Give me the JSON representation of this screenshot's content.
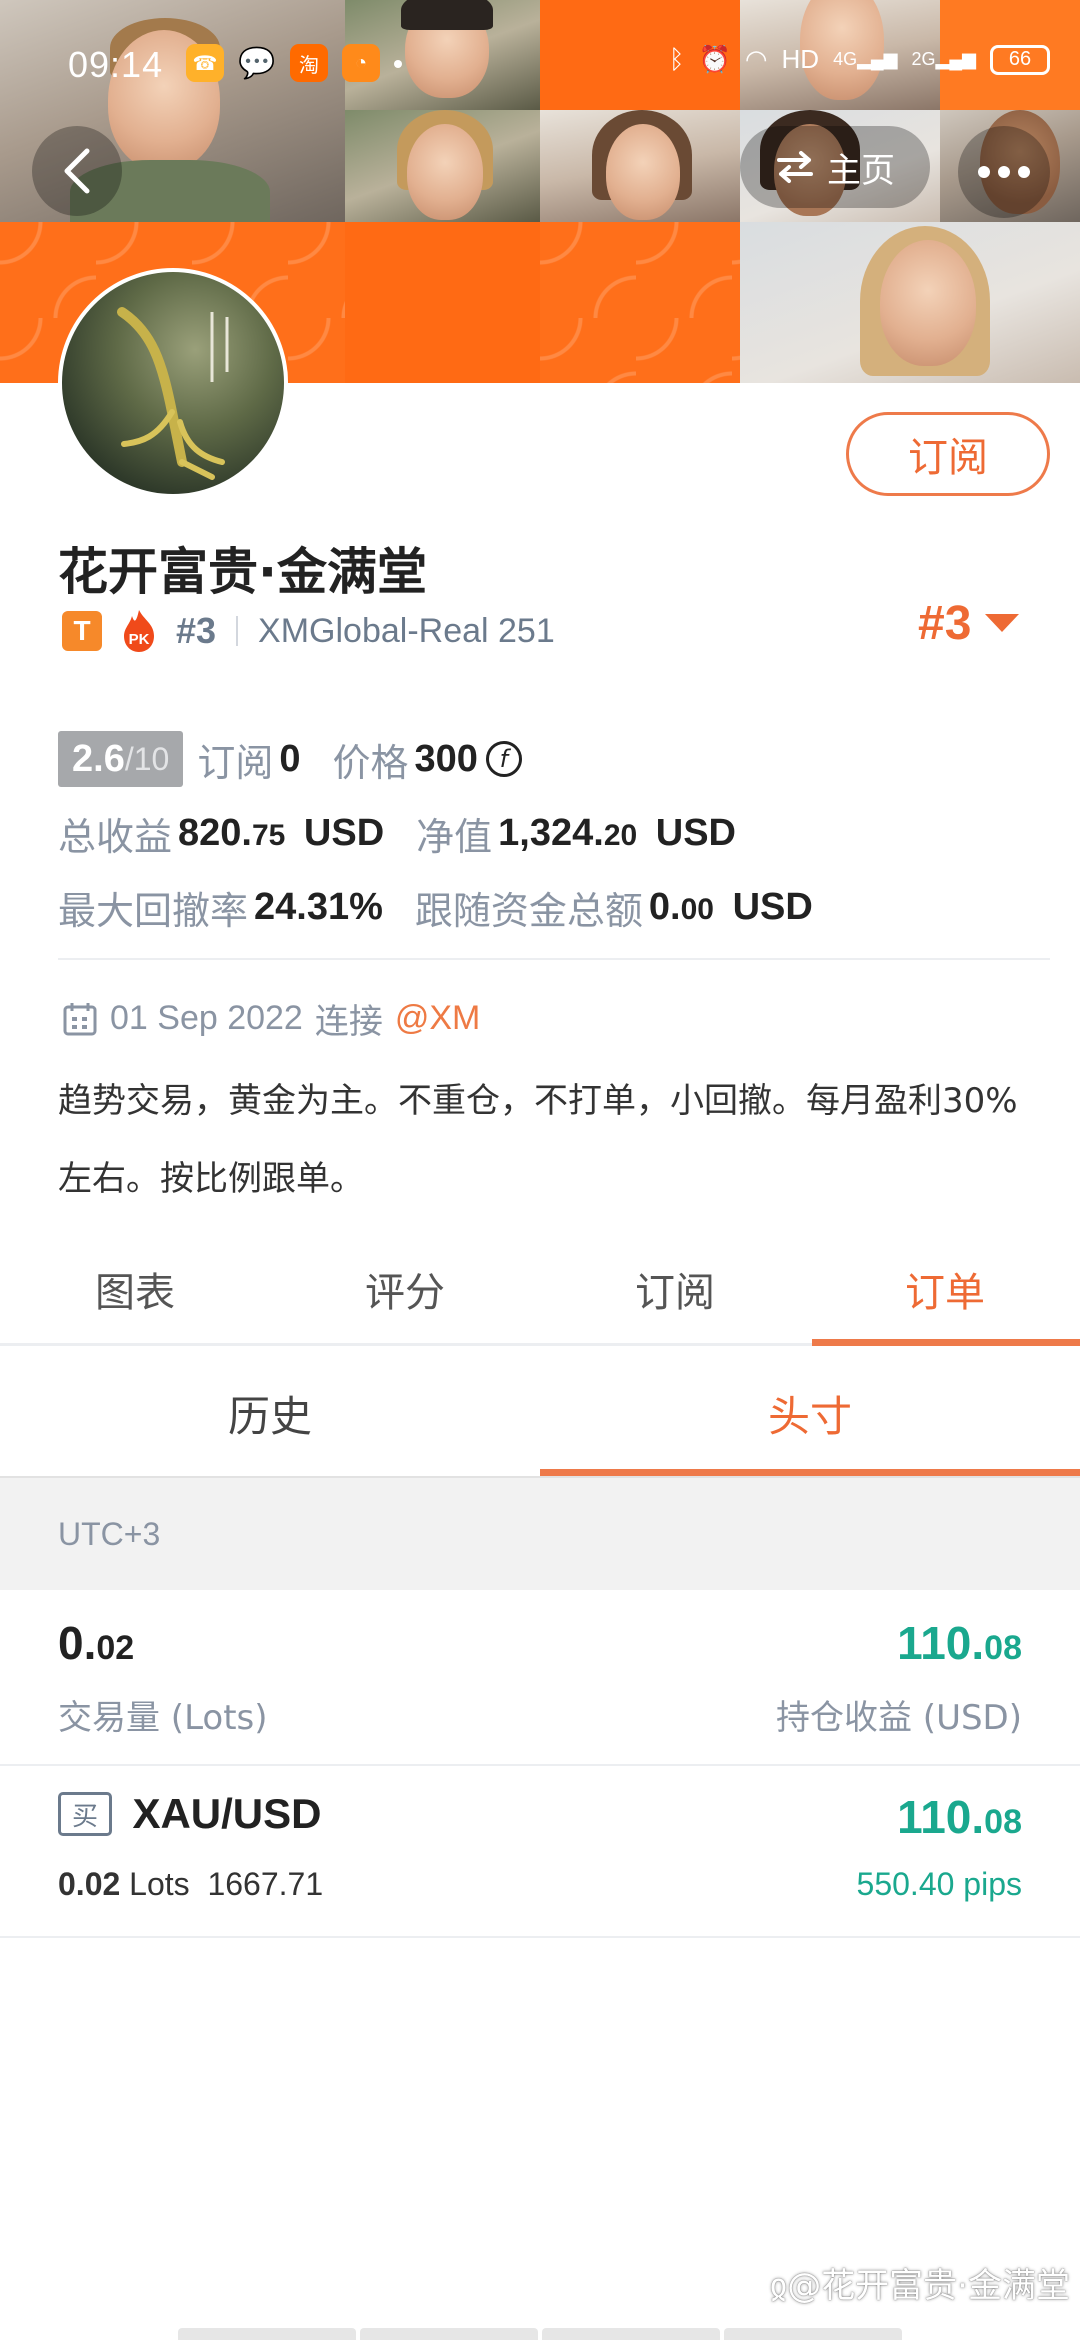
{
  "status_bar": {
    "time": "09:14",
    "network": "HD",
    "signal_1": "4G",
    "signal_2": "2G",
    "battery": "66"
  },
  "header": {
    "home_label": "主页"
  },
  "profile": {
    "name": "花开富贵·金满堂",
    "badge_t": "T",
    "badge_pk": "PK",
    "rank_small": "#3",
    "account": "XMGlobal-Real 251",
    "rank_big": "#3",
    "subscribe_label": "订阅"
  },
  "stats": {
    "rating_main": "2.6",
    "rating_sub": "/10",
    "subscribe_label": "订阅",
    "subscribe_value": "0",
    "price_label": "价格",
    "price_value": "300",
    "price_coin": "f",
    "total_profit_label": "总收益",
    "total_profit_int": "820.",
    "total_profit_dec": "75",
    "total_profit_unit": "USD",
    "equity_label": "净值",
    "equity_int": "1,324.",
    "equity_dec": "20",
    "equity_unit": "USD",
    "max_drawdown_label": "最大回撤率",
    "max_drawdown_value": "24.31%",
    "follow_funds_label": "跟随资金总额",
    "follow_funds_int": "0.",
    "follow_funds_dec": "00",
    "follow_funds_unit": "USD"
  },
  "meta": {
    "date": "01 Sep 2022",
    "connect_label": "连接",
    "broker": "@XM"
  },
  "description": "趋势交易，黄金为主。不重仓，不打单，小回撤。每月盈利30%左右。按比例跟单。",
  "tabs": [
    "图表",
    "评分",
    "订阅",
    "订单"
  ],
  "subtabs": [
    "历史",
    "头寸"
  ],
  "timezone": "UTC+3",
  "summary": {
    "volume_int": "0.",
    "volume_dec": "02",
    "volume_label": "交易量 (Lots)",
    "profit_int": "110.",
    "profit_dec": "08",
    "profit_label": "持仓收益 (USD)"
  },
  "position": {
    "side": "买",
    "symbol": "XAU/USD",
    "lots_value": "0.02",
    "lots_label": "Lots",
    "open_price": "1667.71",
    "profit_int": "110.",
    "profit_dec": "08",
    "pips": "550.40 pips"
  },
  "watermark": "@花开富贵·金满堂",
  "colors": {
    "accent": "#ee6a34",
    "banner": "#ff6a14",
    "profit": "#1aa88e"
  }
}
